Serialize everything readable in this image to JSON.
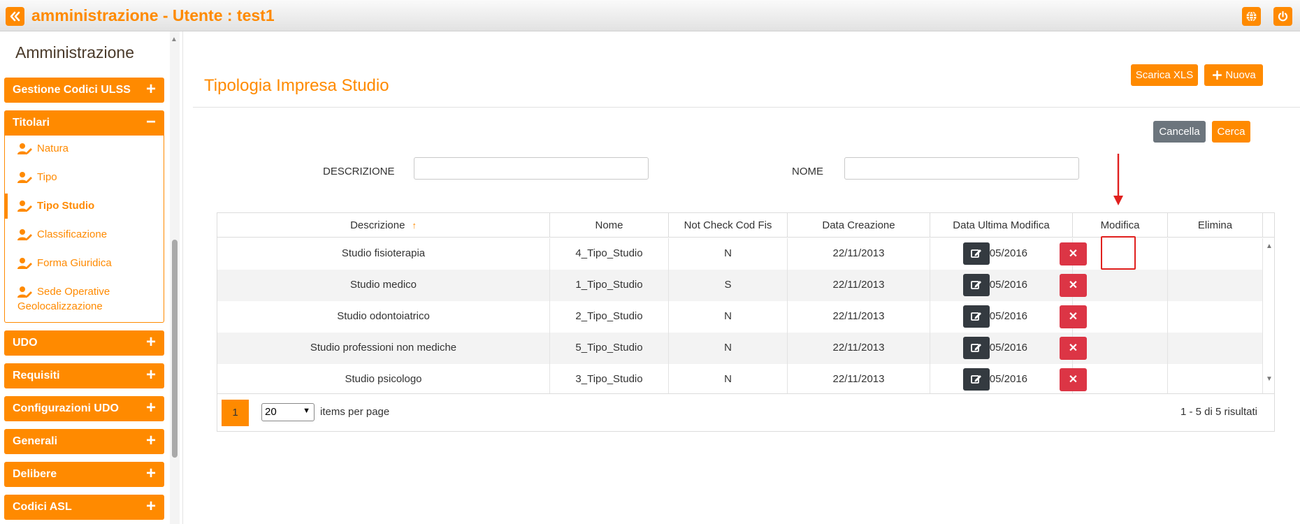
{
  "header": {
    "title": "amministrazione - Utente : test1"
  },
  "sidebar": {
    "title": "Amministrazione",
    "groups": [
      {
        "label": "Gestione Codici ULSS",
        "sign": "+"
      },
      {
        "label": "Titolari",
        "sign": "−"
      },
      {
        "label": "UDO",
        "sign": "+"
      },
      {
        "label": "Requisiti",
        "sign": "+"
      },
      {
        "label": "Configurazioni UDO",
        "sign": "+"
      },
      {
        "label": "Generali",
        "sign": "+"
      },
      {
        "label": "Delibere",
        "sign": "+"
      },
      {
        "label": "Codici ASL",
        "sign": "+"
      }
    ],
    "titolari_items": [
      {
        "label": "Natura"
      },
      {
        "label": "Tipo"
      },
      {
        "label": "Tipo Studio"
      },
      {
        "label": "Classificazione"
      },
      {
        "label": "Forma Giuridica"
      },
      {
        "label": "Sede Operative",
        "label2": "Geolocalizzazione"
      }
    ],
    "active_item": "Tipo Studio"
  },
  "main": {
    "page_title": "Tipologia Impresa Studio",
    "buttons": {
      "download_xls": "Scarica XLS",
      "new": "Nuova",
      "clear": "Cancella",
      "search": "Cerca"
    },
    "filters": {
      "descrizione_label": "DESCRIZIONE",
      "descrizione_value": "",
      "nome_label": "NOME",
      "nome_value": ""
    },
    "table": {
      "columns": [
        "Descrizione",
        "Nome",
        "Not Check Cod Fis",
        "Data Creazione",
        "Data Ultima Modifica",
        "Modifica",
        "Elimina"
      ],
      "sort_indicator": "↑",
      "rows": [
        {
          "descrizione": "Studio fisioterapia",
          "nome": "4_Tipo_Studio",
          "not_check": "N",
          "data_creazione": "22/11/2013",
          "data_modifica": "24/05/2016"
        },
        {
          "descrizione": "Studio medico",
          "nome": "1_Tipo_Studio",
          "not_check": "S",
          "data_creazione": "22/11/2013",
          "data_modifica": "24/05/2016"
        },
        {
          "descrizione": "Studio odontoiatrico",
          "nome": "2_Tipo_Studio",
          "not_check": "N",
          "data_creazione": "22/11/2013",
          "data_modifica": "24/05/2016"
        },
        {
          "descrizione": "Studio professioni non mediche",
          "nome": "5_Tipo_Studio",
          "not_check": "N",
          "data_creazione": "22/11/2013",
          "data_modifica": "24/05/2016"
        },
        {
          "descrizione": "Studio psicologo",
          "nome": "3_Tipo_Studio",
          "not_check": "N",
          "data_creazione": "22/11/2013",
          "data_modifica": "24/05/2016"
        }
      ],
      "delete_glyph": "✕"
    },
    "pager": {
      "current_page": "1",
      "page_size": "20",
      "items_per_page_label": "items per page",
      "results": "1 - 5 di 5 risultati"
    }
  },
  "colors": {
    "accent": "#ff8a00",
    "edit_button": "#343a40",
    "delete_button": "#dc3545",
    "secondary_button": "#6c757d",
    "annotation_red": "#e0201e"
  },
  "icons": [
    "double-chevron-left-icon",
    "globe-icon",
    "power-icon",
    "user-edit-icon",
    "plus-icon",
    "edit-icon",
    "close-icon",
    "arrow-down-annotation"
  ]
}
